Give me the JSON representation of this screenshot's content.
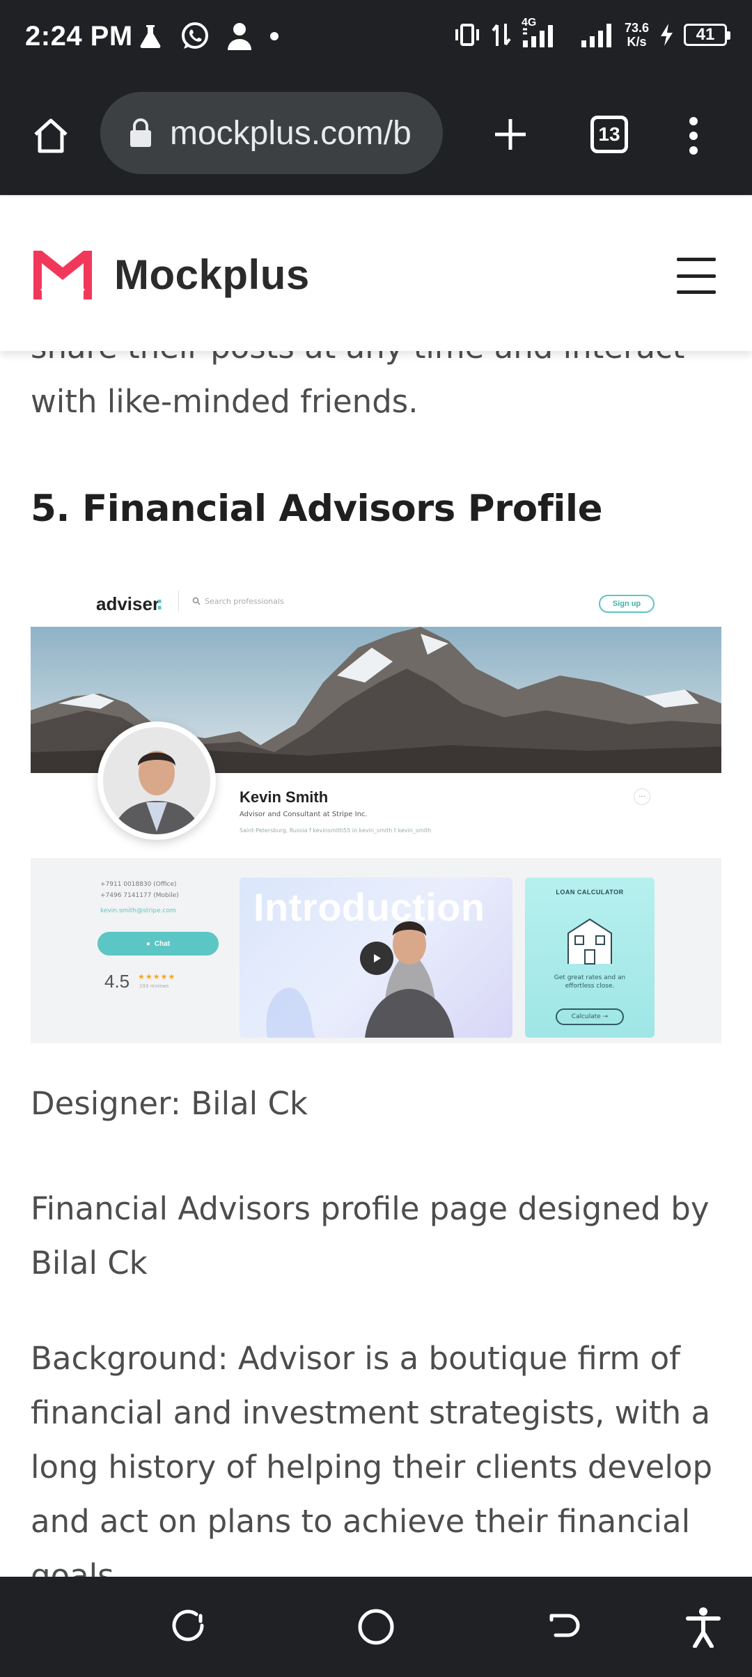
{
  "status_bar": {
    "time": "2:24 PM",
    "network_speed_value": "73.6",
    "network_speed_unit": "K/s",
    "network_type": "4G",
    "battery_level": "41",
    "icons": [
      "flask-icon",
      "whatsapp-icon",
      "person-icon",
      "dot-icon",
      "vibrate-icon",
      "data-arrows-icon",
      "signal-icon",
      "signal-icon-2",
      "charging-icon",
      "battery-icon"
    ]
  },
  "browser": {
    "url": "mockplus.com/b",
    "tab_count": "13",
    "icons": [
      "home-icon",
      "lock-icon",
      "plus-icon",
      "more-vert-icon"
    ]
  },
  "site": {
    "logo_text": "Mockplus",
    "brand_color": "#f2385a"
  },
  "article": {
    "intro_text": "share their posts at any time and interact with like-minded friends.",
    "heading": "5. Financial Advisors Profile",
    "designer": "Designer: Bilal Ck",
    "description": "Financial Advisors profile page designed by Bilal Ck",
    "background": "Background: Advisor is a boutique firm of financial and investment strategists, with a long history of helping their clients develop and act on plans to achieve their financial goals."
  },
  "design_image": {
    "brand": "adviser",
    "search_placeholder": "Search professionals",
    "signup": "Sign up",
    "name": "Kevin Smith",
    "title": "Advisor and Consultant at Stripe Inc.",
    "meta": "Saint-Petersburg, Russia   f  kevinsmith55   in  kevin_smith   t  kevin_smith",
    "phone_office": "+7911 0018830  (Office)",
    "phone_mobile": "+7496 7141177  (Mobile)",
    "email": "kevin.smith@stripe.com",
    "chat": "Chat",
    "rating": "4.5",
    "stars": "★★★★★",
    "reviews": "193 reviews",
    "intro": "Introduction",
    "loan_title": "LOAN CALCULATOR",
    "loan_desc": "Get great rates and an effortless close.",
    "loan_btn": "Calculate →"
  },
  "nav": {
    "icons": [
      "recent-apps-icon",
      "home-circle-icon",
      "back-icon",
      "accessibility-icon"
    ]
  }
}
